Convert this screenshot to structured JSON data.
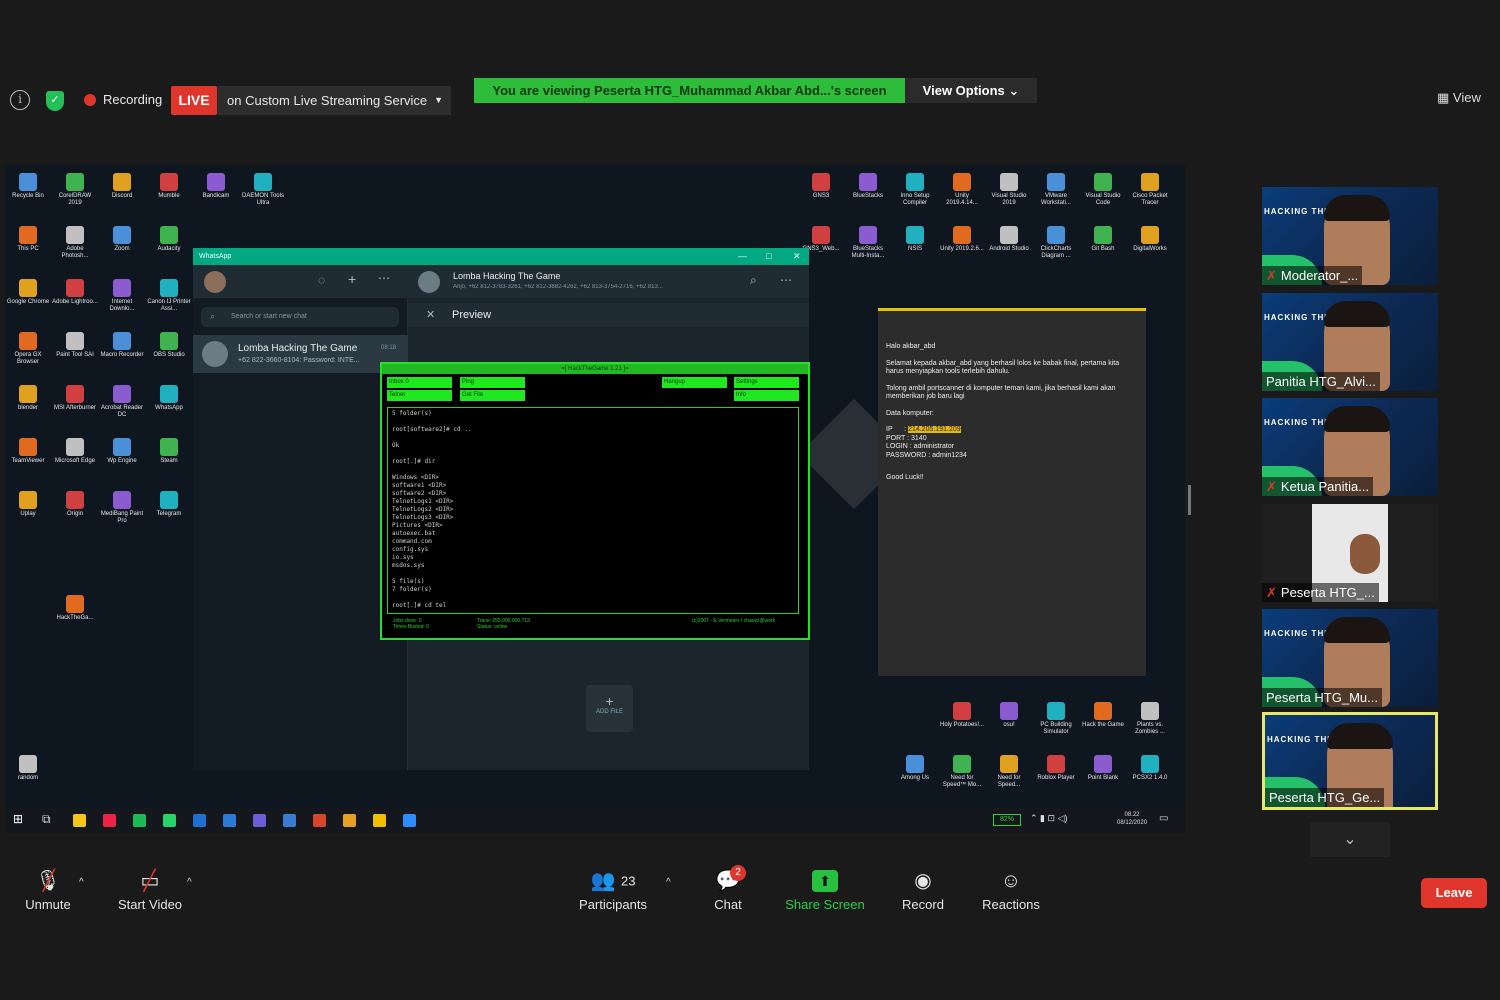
{
  "top_bar": {
    "recording_label": "Recording",
    "live_label": "LIVE",
    "stream_label": "on Custom Live Streaming Service",
    "viewing_banner": "You are viewing Peserta HTG_Muhammad Akbar Abd...'s screen",
    "view_options_label": "View Options",
    "view_label": "View"
  },
  "desktop": {
    "left_icons": [
      "Recycle Bin",
      "CorelDRAW 2019",
      "Discord",
      "Mumble",
      "Bandicam",
      "DAEMON Tools Ultra",
      "This PC",
      "Adobe Photosh...",
      "Zoom",
      "Audacity",
      "Google Chrome",
      "Adobe Lightroo...",
      "Internet Downlo...",
      "Canon IJ Printer Assi...",
      "Opera GX Browser",
      "Paint Tool SAI",
      "Macro Recorder",
      "OBS Studio",
      "blender",
      "MSI Afterburner",
      "Acrobat Reader DC",
      "WhatsApp",
      "TeamViewer",
      "Microsoft Edge",
      "Wp Engine",
      "Steam",
      "Uplay",
      "Origin",
      "MediBang Paint Pro",
      "Telegram",
      "HackTheGa...",
      "random"
    ],
    "right_icons": [
      "GNS3",
      "BlueStacks",
      "Inno Setup Compiler",
      "Unity 2019.4.14...",
      "Visual Studio 2019",
      "VMware Workstati...",
      "Visual Studio Code",
      "Cisco Packet Tracer",
      "GNS3_Web...",
      "BlueStacks Multi-Insta...",
      "NSIS",
      "Unity 2019.2.6...",
      "Android Studio",
      "ClickCharts Diagram ...",
      "Git Bash",
      "DigitalWorks",
      "Holy Potatoes!...",
      "osu!",
      "PC Building Simulator",
      "Hack the Game",
      "Plants vs. Zombies ...",
      "Among Us",
      "Need for Speed™ Mo...",
      "Need for Speed...",
      "Roblox Player",
      "Point Blank",
      "PCSX2 1.4.0"
    ]
  },
  "whatsapp": {
    "title": "WhatsApp",
    "search_placeholder": "Search or start new chat",
    "chat_name": "Lomba Hacking The Game",
    "chat_preview": "+62 822-3660-8104: Password: INTE...",
    "chat_time": "08:18",
    "header_name": "Lomba Hacking The Game",
    "header_members": "Anjo, +62 812-3783-3261, +62 812-3882-4262, +62 813-3754-2716, +62 813...",
    "preview_label": "Preview",
    "add_file_label": "ADD FILE"
  },
  "terminal": {
    "title": "=[ HackTheGame 1.21 ]=",
    "buttons": [
      "Inbox 0",
      "Ping",
      "Hangup",
      "Settings",
      "Telnet",
      "Get File",
      "Info"
    ],
    "lines": [
      "5 folder(s)",
      "",
      "root[software2]# cd ..",
      "",
      "Ok",
      "",
      "root[.]# dir",
      "",
      "Windows <DIR>",
      "software1 <DIR>",
      "software2 <DIR>",
      "TelnetLogs1 <DIR>",
      "TelnetLogs2 <DIR>",
      "TelnetLogs3 <DIR>",
      "Pictures <DIR>",
      "autoexec.bat",
      "command.com",
      "config.sys",
      "io.sys",
      "msdos.sys",
      "",
      "5 file(s)",
      "7 folder(s)",
      "",
      "root[.]# cd tel"
    ],
    "footer_left": "Jobs done: 0\nTimes Busted: 0",
    "footer_mid": "Trace: 255.000.000.713\nStatus: online",
    "footer_right": "(c)2007 - E.Vermeers / chaozz@work"
  },
  "note": {
    "greeting": "Halo akbar_abd",
    "para1": "Selamat kepada akbar_abd yang berhasil lolos ke babak final, pertama kita harus menyiapkan tools terlebih dahulu.",
    "para2": "Tolong ambil portscanner di komputer teman kami, jika berhasil kami akan memberikan job baru lagi",
    "data_label": "Data komputer:",
    "ip_key": "IP",
    "ip_value": "214.205.191.209",
    "port_line": "PORT    : 3140",
    "login_line": "LOGIN   : administrator",
    "password_line": "PASSWORD : admin1234",
    "closing": "Good Luck!!"
  },
  "taskbar": {
    "battery": "82%",
    "time": "08.22",
    "date": "08/12/2020"
  },
  "participants": [
    {
      "name": "Moderator_..."
    },
    {
      "name": "Panitia HTG_Alvi..."
    },
    {
      "name": "Ketua Panitia..."
    },
    {
      "name": "Peserta HTG_..."
    },
    {
      "name": "Peserta HTG_Mu..."
    },
    {
      "name": "Peserta HTG_Ge..."
    }
  ],
  "tile_brand": "HACKING THE GAME",
  "controls": {
    "unmute": "Unmute",
    "start_video": "Start Video",
    "participants": "Participants",
    "participants_count": "23",
    "chat": "Chat",
    "chat_badge": "2",
    "share_screen": "Share Screen",
    "record": "Record",
    "reactions": "Reactions",
    "leave": "Leave"
  }
}
